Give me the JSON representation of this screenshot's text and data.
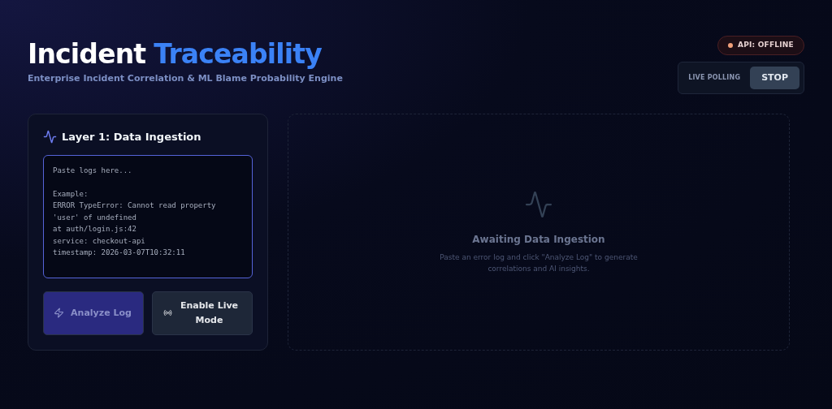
{
  "header": {
    "title": "Incident",
    "title_accent": "Traceability",
    "subtitle": "Enterprise Incident Correlation & ML Blame Probability Engine"
  },
  "api_status": {
    "label": "API: OFFLINE",
    "color": "#f0a07a"
  },
  "polling": {
    "label": "LIVE POLLING",
    "button": "STOP"
  },
  "ingestion": {
    "title": "Layer 1: Data Ingestion",
    "log_field": {
      "placeholder": "Paste logs here...\n\nExample:\nERROR TypeError: Cannot read property\n'user' of undefined\nat auth/login.js:42\nservice: checkout-api\ntimestamp: 2026-03-07T10:32:11"
    },
    "buttons": [
      {
        "kind": "analyze",
        "label": "Analyze Log",
        "disabled": true
      },
      {
        "kind": "live",
        "label": "Enable Live Mode",
        "disabled": false
      }
    ]
  },
  "results": {
    "title": "Awaiting Data Ingestion",
    "message": "Paste an error log and click \"Analyze Log\" to generate correlations and AI insights."
  }
}
